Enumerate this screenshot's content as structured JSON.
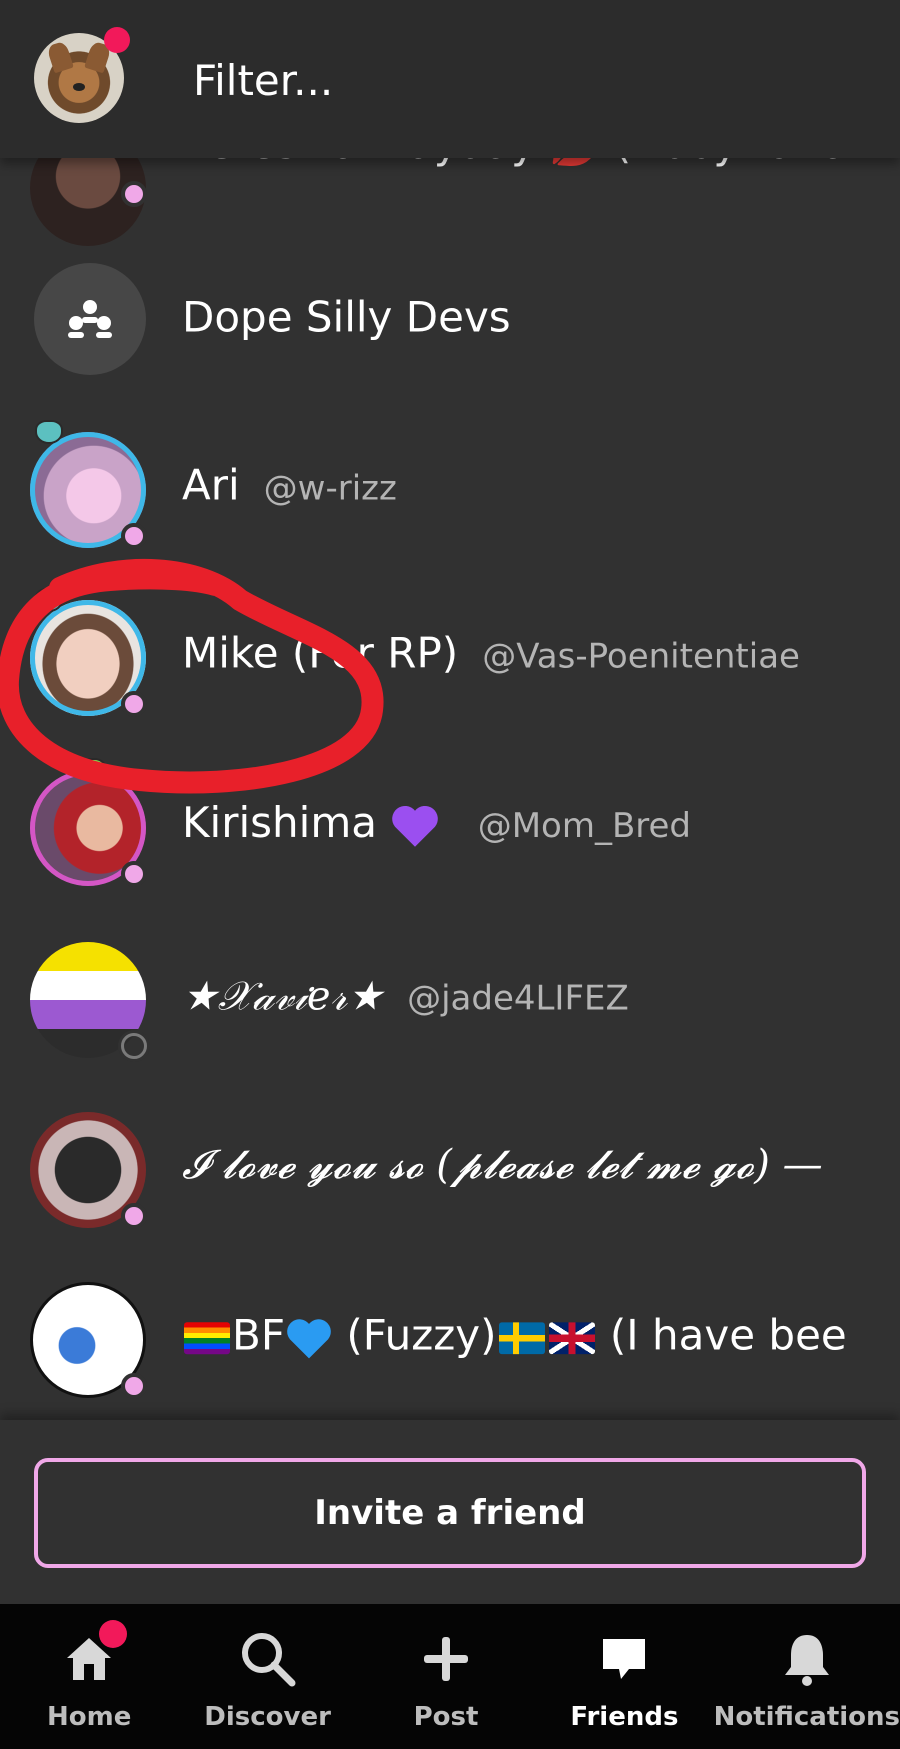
{
  "header": {
    "filter_placeholder": "Filter..."
  },
  "friends": [
    {
      "name": "Veresika Mayday 💋 (Abby for a",
      "handle": ""
    },
    {
      "name": "Dope Silly Devs",
      "handle": "",
      "type": "group"
    },
    {
      "name": "Ari",
      "handle": "@w-rizz"
    },
    {
      "name": "Mike (For RP)",
      "handle": "@Vas-Poenitentiae"
    },
    {
      "name": "Kirishima",
      "handle": "@Mom_Bred"
    },
    {
      "name": "★𝒳𝒶𝓋𝒾𝑒𝓇★",
      "handle": "@jade4LIFEZ"
    },
    {
      "name": "𝓘 𝓵𝓸𝓿𝓮 𝔂𝓸𝓾 𝓼𝓸 (𝓹𝓵𝓮𝓪𝓼𝓮 𝓵𝓮𝓽 𝓶𝓮 𝓰𝓸) —",
      "handle": ""
    },
    {
      "name_parts": [
        "BF",
        "(Fuzzy)",
        "(I have bee"
      ],
      "handle": ""
    }
  ],
  "invite": {
    "label": "Invite a friend"
  },
  "nav": {
    "items": [
      {
        "label": "Home",
        "icon": "home-icon"
      },
      {
        "label": "Discover",
        "icon": "search-icon"
      },
      {
        "label": "Post",
        "icon": "plus-icon"
      },
      {
        "label": "Friends",
        "icon": "chat-bubble-icon",
        "active": true
      },
      {
        "label": "Notifications",
        "icon": "bell-icon"
      }
    ]
  },
  "colors": {
    "background": "#313131",
    "accent_pink": "#f0a8e8",
    "notification_red": "#f2195a",
    "annotation_red": "#e8202a"
  }
}
